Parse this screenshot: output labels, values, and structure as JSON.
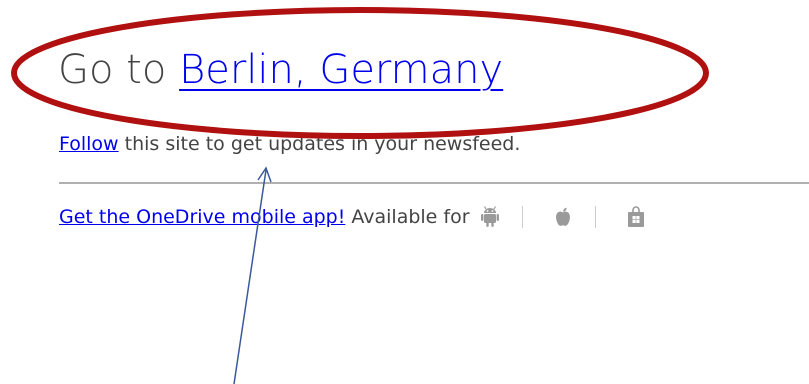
{
  "heading": {
    "prefix": "Go to ",
    "link_text": "Berlin, Germany"
  },
  "follow": {
    "link_text": "Follow",
    "rest_text": " this site to get updates in your newsfeed."
  },
  "app_promo": {
    "link_text": "Get the OneDrive mobile app!",
    "available_text": "Available for",
    "platform_icons": [
      "android-icon",
      "apple-icon",
      "windows-store-icon"
    ]
  },
  "colors": {
    "link": "#0000ee",
    "text": "#444444",
    "annotation_ellipse": "#b01010",
    "annotation_arrow": "#3a5a9a"
  }
}
